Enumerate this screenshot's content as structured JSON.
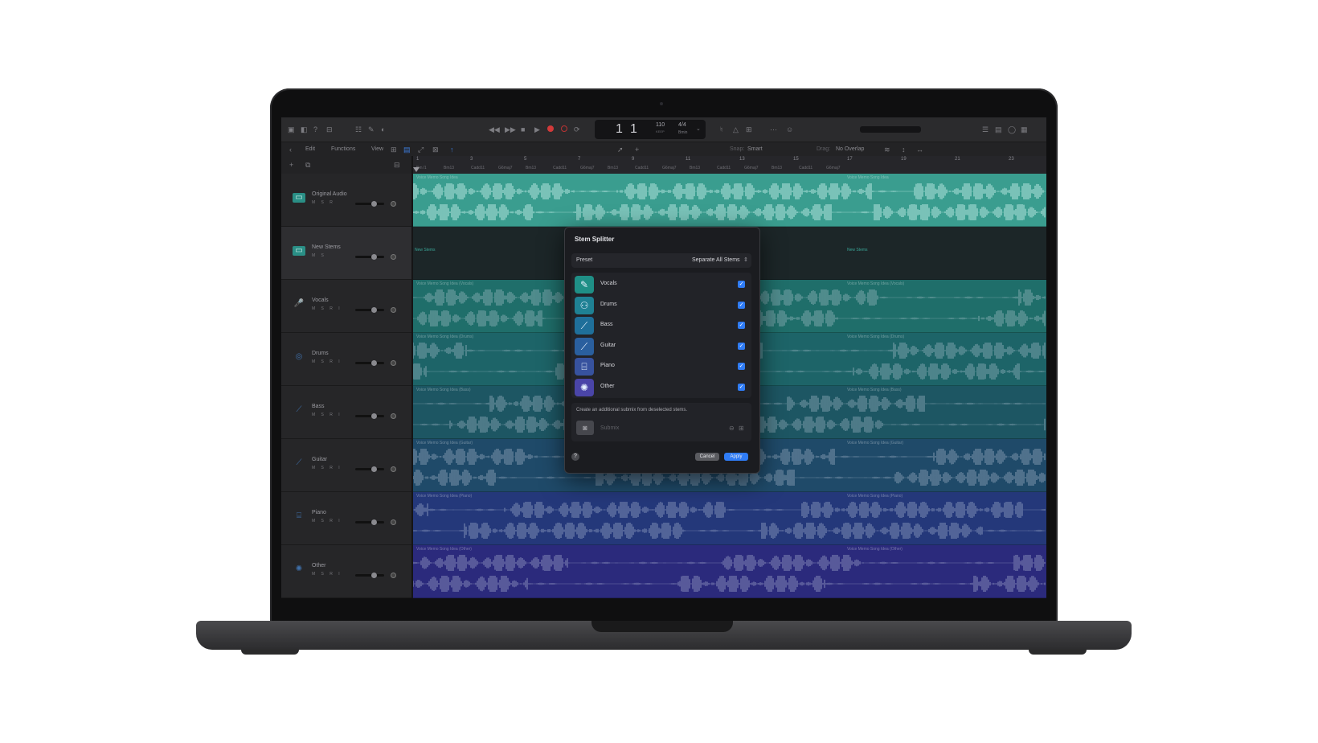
{
  "toolbar": {
    "lcd_bar": "1",
    "lcd_beat": "1",
    "lcd_tempo": "110",
    "lcd_tempo_unit": "KEEP",
    "lcd_signature": "4/4",
    "lcd_key": "Bmin"
  },
  "menubar": {
    "edit": "Edit",
    "functions": "Functions",
    "view": "View",
    "snap_label": "Snap:",
    "snap_value": "Smart",
    "drag_label": "Drag:",
    "drag_value": "No Overlap"
  },
  "ruler": {
    "bars": [
      "1",
      "3",
      "5",
      "7",
      "9",
      "11",
      "13",
      "15",
      "17",
      "19",
      "21",
      "23"
    ],
    "chords": [
      "Bm /1",
      "Bm13",
      "Cadd11",
      "G6maj7",
      "Bm13",
      "Cadd11",
      "G6maj7",
      "Bm13",
      "Cadd11",
      "G6maj7",
      "Bm13",
      "Cadd11",
      "G6maj7",
      "Bm13",
      "Cadd11",
      "G6maj7"
    ]
  },
  "tracks": [
    {
      "name": "Original Audio",
      "controls": "M S R",
      "icon": "audio-track-icon",
      "color": "#3a9d8f",
      "region": "Voice Memo Song Idea"
    },
    {
      "name": "New Stems",
      "controls": "M S",
      "icon": "folder-track-icon",
      "color": "#2b8f8a",
      "region": "New Stems"
    },
    {
      "name": "Vocals",
      "controls": "M S R I",
      "icon": "microphone-icon",
      "color": "#1f6e6a",
      "region": "Voice Memo Song Idea (Vocals)"
    },
    {
      "name": "Drums",
      "controls": "M S R I",
      "icon": "drums-icon",
      "color": "#1d6468",
      "region": "Voice Memo Song Idea (Drums)"
    },
    {
      "name": "Bass",
      "controls": "M S R I",
      "icon": "bass-guitar-icon",
      "color": "#1d5663",
      "region": "Voice Memo Song Idea (Bass)"
    },
    {
      "name": "Guitar",
      "controls": "M S R I",
      "icon": "guitar-icon",
      "color": "#1f4a69",
      "region": "Voice Memo Song Idea (Guitar)"
    },
    {
      "name": "Piano",
      "controls": "M S R I",
      "icon": "piano-icon",
      "color": "#24387a",
      "region": "Voice Memo Song Idea (Piano)"
    },
    {
      "name": "Other",
      "controls": "M S R I",
      "icon": "waveform-icon",
      "color": "#2b2a7c",
      "region": "Voice Memo Song Idea (Other)"
    }
  ],
  "dialog": {
    "title": "Stem Splitter",
    "preset_label": "Preset",
    "preset_value": "Separate All Stems",
    "stems": [
      {
        "label": "Vocals",
        "checked": true,
        "icon": "microphone-icon",
        "color": "#1f8f86"
      },
      {
        "label": "Drums",
        "checked": true,
        "icon": "drums-icon",
        "color": "#1f8194"
      },
      {
        "label": "Bass",
        "checked": true,
        "icon": "bass-guitar-icon",
        "color": "#1f6f9a"
      },
      {
        "label": "Guitar",
        "checked": true,
        "icon": "guitar-icon",
        "color": "#2a5f9e"
      },
      {
        "label": "Piano",
        "checked": true,
        "icon": "piano-icon",
        "color": "#37529e"
      },
      {
        "label": "Other",
        "checked": true,
        "icon": "waveform-icon",
        "color": "#4a45a8"
      }
    ],
    "submix_hint": "Create an additional submix from deselected stems.",
    "submix_placeholder": "Submix",
    "help": "?",
    "cancel": "Cancel",
    "apply": "Apply"
  }
}
